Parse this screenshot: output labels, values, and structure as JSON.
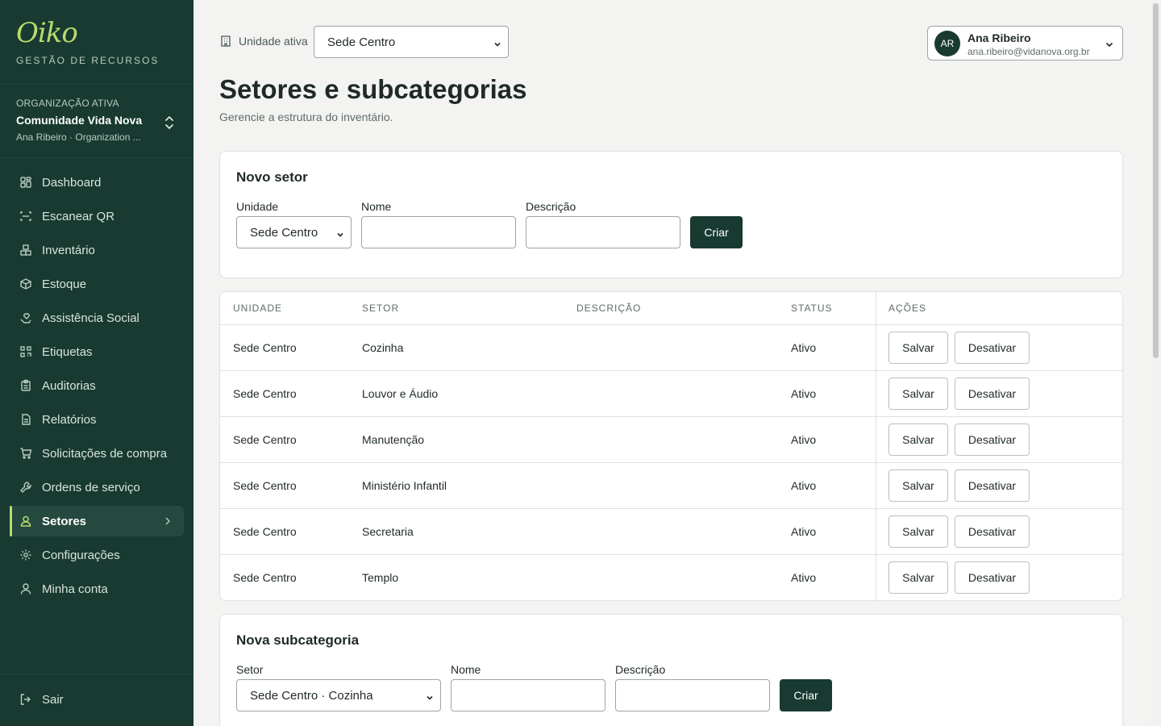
{
  "brand": {
    "logo": "Oiko",
    "tagline": "GESTÃO DE RECURSOS"
  },
  "org": {
    "label": "ORGANIZAÇÃO ATIVA",
    "name": "Comunidade Vida Nova",
    "sub": "Ana Ribeiro · Organization ..."
  },
  "nav": [
    {
      "label": "Dashboard",
      "icon": "grid-icon"
    },
    {
      "label": "Escanear QR",
      "icon": "scan-icon"
    },
    {
      "label": "Inventário",
      "icon": "boxes-icon"
    },
    {
      "label": "Estoque",
      "icon": "package-icon"
    },
    {
      "label": "Assistência Social",
      "icon": "hand-heart-icon"
    },
    {
      "label": "Etiquetas",
      "icon": "qr-icon"
    },
    {
      "label": "Auditorias",
      "icon": "clipboard-icon"
    },
    {
      "label": "Relatórios",
      "icon": "report-icon"
    },
    {
      "label": "Solicitações de compra",
      "icon": "cart-icon"
    },
    {
      "label": "Ordens de serviço",
      "icon": "wrench-icon"
    },
    {
      "label": "Setores",
      "icon": "sector-icon",
      "active": true
    },
    {
      "label": "Configurações",
      "icon": "gear-icon"
    },
    {
      "label": "Minha conta",
      "icon": "user-icon"
    }
  ],
  "logout": "Sair",
  "topbar": {
    "unit_label": "Unidade ativa",
    "unit_value": "Sede Centro"
  },
  "user": {
    "initials": "AR",
    "name": "Ana Ribeiro",
    "email": "ana.ribeiro@vidanova.org.br"
  },
  "page": {
    "title": "Setores e subcategorias",
    "subtitle": "Gerencie a estrutura do inventário."
  },
  "new_sector": {
    "title": "Novo setor",
    "unit_label": "Unidade",
    "unit_value": "Sede Centro",
    "name_label": "Nome",
    "name_value": "",
    "desc_label": "Descrição",
    "desc_value": "",
    "submit": "Criar"
  },
  "table": {
    "headers": [
      "UNIDADE",
      "SETOR",
      "DESCRIÇÃO",
      "STATUS",
      "AÇÕES"
    ],
    "rows": [
      {
        "unit": "Sede Centro",
        "sector": "Cozinha",
        "desc": "",
        "status": "Ativo"
      },
      {
        "unit": "Sede Centro",
        "sector": "Louvor e Áudio",
        "desc": "",
        "status": "Ativo"
      },
      {
        "unit": "Sede Centro",
        "sector": "Manutenção",
        "desc": "",
        "status": "Ativo"
      },
      {
        "unit": "Sede Centro",
        "sector": "Ministério Infantil",
        "desc": "",
        "status": "Ativo"
      },
      {
        "unit": "Sede Centro",
        "sector": "Secretaria",
        "desc": "",
        "status": "Ativo"
      },
      {
        "unit": "Sede Centro",
        "sector": "Templo",
        "desc": "",
        "status": "Ativo"
      }
    ],
    "save_label": "Salvar",
    "deactivate_label": "Desativar"
  },
  "new_subcategory": {
    "title": "Nova subcategoria",
    "sector_label": "Setor",
    "sector_value": "Sede Centro · Cozinha",
    "name_label": "Nome",
    "name_value": "",
    "desc_label": "Descrição",
    "desc_value": "",
    "submit": "Criar"
  },
  "colors": {
    "sidebar": "#183a31",
    "accent": "#b9dc6c",
    "primary_button": "#183a31"
  }
}
